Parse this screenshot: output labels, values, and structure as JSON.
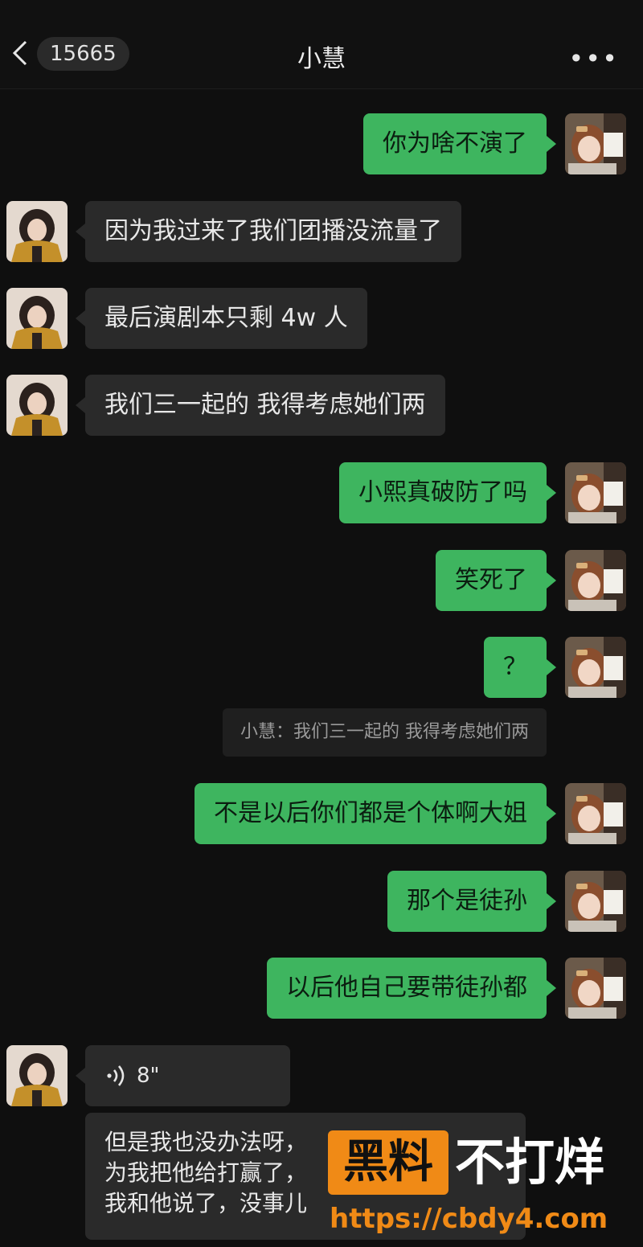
{
  "header": {
    "unread_count": "15665",
    "contact_name": "小慧",
    "more": "•••"
  },
  "messages": [
    {
      "text": "你为啥不演了"
    },
    {
      "text": "因为我过来了我们团播没流量了"
    },
    {
      "text": "最后演剧本只剩 4w 人"
    },
    {
      "text": "我们三一起的 我得考虑她们两"
    },
    {
      "text": "小熙真破防了吗"
    },
    {
      "text": "笑死了"
    },
    {
      "text": "？"
    },
    {
      "quote": "小慧：我们三一起的 我得考虑她们两"
    },
    {
      "text": "不是以后你们都是个体啊大姐"
    },
    {
      "text": "那个是徒孙"
    },
    {
      "text": "以后他自己要带徒孙都"
    }
  ],
  "voice": {
    "duration": "8\""
  },
  "long_message": {
    "lines": [
      "但是我也没办法呀，",
      "为我把他给打赢了，",
      "我和他说了，没事儿"
    ]
  },
  "watermark": {
    "brand1": "黑料",
    "brand2": "不打烊",
    "url": "https://cbdy4.com"
  },
  "colors": {
    "sent_bubble": "#3eb55f",
    "received_bubble": "#2a2a2a",
    "background": "#0f0f0f",
    "watermark_orange": "#f08a16"
  }
}
